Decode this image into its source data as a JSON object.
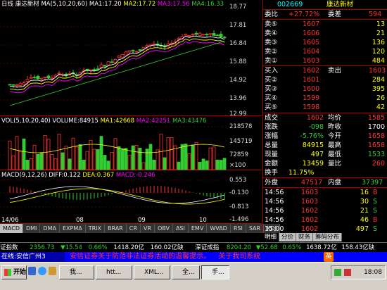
{
  "chart_header": {
    "period": "日线",
    "name": "康达新材",
    "ma5": "MA(5,10,20,60) MA1:17.20",
    "ma2": "MA2:17.72",
    "ma3": "MA3:17.56",
    "ma4": "MA4:16.33"
  },
  "price_axis": [
    "18.77",
    "17.81",
    "16.84",
    "15.88",
    "14.92",
    "13.96",
    "12.99"
  ],
  "vol_header": {
    "title": "VOL(5,10,20,40) VOLUME:84915",
    "ma1": "MA1:42668",
    "ma2": "MA2:42251",
    "ma3": "MA3:43476"
  },
  "vol_axis": [
    "218578",
    "145719",
    "72859",
    "×100"
  ],
  "macd_header": {
    "title": "MACD(9,12,26) DIFF:0.122",
    "dea": "DEA:0.367",
    "macd": "MACD:-0.246"
  },
  "macd_axis": [
    "0.553",
    "-0.130",
    "-0.813",
    "-1.496"
  ],
  "date_axis": [
    "14/06",
    "08",
    "09",
    "10"
  ],
  "tabs": [
    "MACD",
    "DMI",
    "DMA",
    "EXPMA",
    "TRIX",
    "BRAR",
    "CR",
    "VR",
    "OBV",
    "ASI",
    "EMV",
    "WVAD",
    "RSI",
    "SAR",
    "KDJ"
  ],
  "quote": {
    "code": "002669",
    "name": "康达新材",
    "ratio_label": "委比",
    "ratio": "+27.72%",
    "diff_label": "委差",
    "diff": "594",
    "sells": [
      {
        "label": "卖⑤",
        "price": "1607",
        "vol": "13"
      },
      {
        "label": "卖④",
        "price": "1606",
        "vol": "21"
      },
      {
        "label": "卖③",
        "price": "1605",
        "vol": "136"
      },
      {
        "label": "卖②",
        "price": "1604",
        "vol": "120"
      },
      {
        "label": "卖①",
        "price": "1603",
        "vol": "484"
      }
    ],
    "buy_label": "买入",
    "buy": "1602",
    "sell_label": "卖出",
    "sell": "1603",
    "buys": [
      {
        "label": "买②",
        "price": "1601",
        "vol": "284"
      },
      {
        "label": "买③",
        "price": "1600",
        "vol": "395"
      },
      {
        "label": "买④",
        "price": "1599",
        "vol": "26"
      },
      {
        "label": "买⑤",
        "price": "1598",
        "vol": "42"
      }
    ],
    "stats": [
      {
        "l1": "成交",
        "v1": "1602",
        "l2": "均价",
        "v2": "1585"
      },
      {
        "l1": "涨跌",
        "v1": "-098",
        "l2": "昨收",
        "v2": "1700"
      },
      {
        "l1": "涨幅",
        "v1": "-5.76%",
        "l2": "今开",
        "v2": "1658"
      },
      {
        "l1": "总量",
        "v1": "84915",
        "l2": "最高",
        "v2": "1658"
      },
      {
        "l1": "现量",
        "v1": "497",
        "l2": "最低",
        "v2": "1533"
      },
      {
        "l1": "金额",
        "v1": "13459",
        "l2": "量比",
        "v2": "260"
      }
    ],
    "turnover_label": "换手",
    "turnover": "11.75%",
    "outer_label": "外盘",
    "outer": "47517",
    "inner_label": "内盘",
    "inner": "37397",
    "ticks": [
      {
        "time": "14:56",
        "price": "1603",
        "vol": "16",
        "bs": "B"
      },
      {
        "time": "14:56",
        "price": "1603",
        "vol": "30",
        "bs": "S"
      },
      {
        "time": "14:56",
        "price": "1602",
        "vol": "21",
        "bs": "S"
      },
      {
        "time": "14:56",
        "price": "1602",
        "vol": "46",
        "bs": "B"
      },
      {
        "time": "15:00",
        "price": "1602",
        "vol": "497",
        "bs": "S"
      }
    ]
  },
  "right_tabs": [
    "明细",
    "分价",
    "财务",
    "筹码分布"
  ],
  "status": {
    "sh_label": "证指数",
    "sh": "2356.73",
    "sh_chg": "▼15.54",
    "sh_pct": "0.66%",
    "sh_amt": "1418.20亿",
    "sh_mid": "160.02亿缺",
    "sz_label": "深证成指",
    "sz": "8204.20",
    "sz_chg": "▼52.68",
    "sz_pct": "0.65%",
    "sz_amt": "1638.72亿",
    "sz_amt2": "158.43亿缺"
  },
  "ticker": {
    "left": "在线:安信广州3",
    "msg": "安信证券关于防范非法证券活动的温馨提示。",
    "msg2": "关于我司系统",
    "brand": "英"
  },
  "taskbar": {
    "start": "开始",
    "buttons": [
      "我...",
      "htt...",
      "XML...",
      "全...",
      "手..."
    ],
    "clock": "18:08"
  },
  "colors": {
    "up": "#ff3333",
    "down": "#33cc33",
    "bg": "#000000",
    "grid": "#aa0000"
  }
}
